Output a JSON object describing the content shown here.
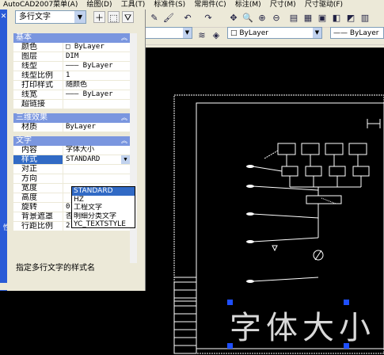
{
  "menubar": {
    "items": [
      "AutoCAD2007菜单(A)",
      "绘图(D)",
      "工具(T)",
      "标准件(S)",
      "常用件(C)",
      "标注(M)",
      "尺寸(M)",
      "尺寸驱动(F)"
    ]
  },
  "toolbar": {
    "layer_color": "ByLayer",
    "linetype": "ByLayer"
  },
  "palette": {
    "object_type": "多行文字",
    "sections": {
      "basic": {
        "title": "基本",
        "rows": [
          {
            "key": "颜色",
            "value": "□ ByLayer"
          },
          {
            "key": "图层",
            "value": "DIM"
          },
          {
            "key": "线型",
            "value": "——— ByLayer"
          },
          {
            "key": "线型比例",
            "value": "1"
          },
          {
            "key": "打印样式",
            "value": "随颜色"
          },
          {
            "key": "线宽",
            "value": "——— ByLayer"
          },
          {
            "key": "超链接",
            "value": ""
          }
        ]
      },
      "effects3d": {
        "title": "三维效果",
        "rows": [
          {
            "key": "材质",
            "value": "ByLayer"
          }
        ]
      },
      "text": {
        "title": "文字",
        "rows": [
          {
            "key": "内容",
            "value": "字体大小"
          },
          {
            "key": "样式",
            "value": "STANDARD"
          },
          {
            "key": "对正",
            "value": ""
          },
          {
            "key": "方向",
            "value": ""
          },
          {
            "key": "宽度",
            "value": ""
          },
          {
            "key": "高度",
            "value": ""
          },
          {
            "key": "旋转",
            "value": "0"
          },
          {
            "key": "背景遮罩",
            "value": "否"
          },
          {
            "key": "行距比例",
            "value": "2"
          }
        ]
      }
    },
    "style_dropdown": {
      "options": [
        "STANDARD",
        "HZ",
        "工程文字",
        "明细分类文字",
        "YC_TEXTSTYLE"
      ],
      "highlighted": 0
    },
    "description": "指定多行文字的样式名"
  },
  "drawing": {
    "text_object": "字体大小"
  }
}
